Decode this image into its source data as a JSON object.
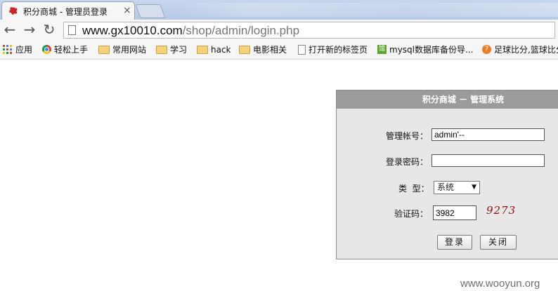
{
  "browser": {
    "tab_title": "积分商城 - 管理员登录",
    "tab_close": "×",
    "url_host": "www.gx10010.com",
    "url_path": "/shop/admin/login.php"
  },
  "bookmarks": [
    {
      "label": "应用",
      "icon": "apps-grid-icon"
    },
    {
      "label": "轻松上手",
      "icon": "chrome-icon"
    },
    {
      "label": "常用网站",
      "icon": "folder-icon"
    },
    {
      "label": "学习",
      "icon": "folder-icon"
    },
    {
      "label": "hack",
      "icon": "folder-icon"
    },
    {
      "label": "电影相关",
      "icon": "folder-icon"
    },
    {
      "label": "打开新的标签页",
      "icon": "page-icon"
    },
    {
      "label": "mysql数据库备份导...",
      "icon": "green-app-icon"
    },
    {
      "label": "足球比分,篮球比分",
      "icon": "orange-ball-icon"
    }
  ],
  "login": {
    "title": "积分商城 － 管理系统",
    "account_label": "管理帐号：",
    "account_value": "admin'--",
    "password_label": "登录密码：",
    "password_value": "",
    "type_label": "类  型：",
    "type_selected": "系统",
    "captcha_label": "验证码：",
    "captcha_value": "3982",
    "captcha_image_text": "9273",
    "login_button": "登录",
    "close_button": "关闭"
  },
  "watermark": "www.wooyun.org",
  "colors": {
    "panel_bg": "#e7e7e7",
    "panel_header": "#9b9b9b",
    "captcha_text": "#8a1010"
  }
}
